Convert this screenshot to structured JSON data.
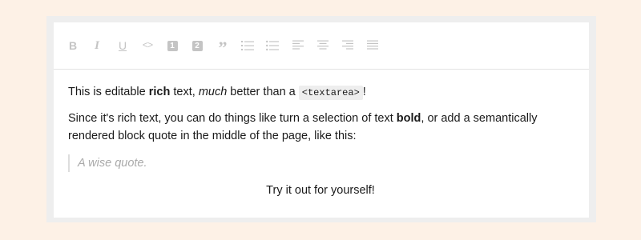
{
  "colors": {
    "page_background": "#fdf1e6",
    "frame_background": "#eeeeee",
    "editor_background": "#ffffff",
    "toolbar_icon": "#c4c4c4",
    "text": "#1a1a1a",
    "quote_text": "#aaaaaa"
  },
  "toolbar": {
    "buttons": [
      {
        "icon": "bold-icon",
        "glyph": "B"
      },
      {
        "icon": "italic-icon",
        "glyph": "I"
      },
      {
        "icon": "underline-icon",
        "glyph": "U"
      },
      {
        "icon": "code-icon",
        "glyph": "<>"
      },
      {
        "icon": "heading-one-icon",
        "glyph": "1"
      },
      {
        "icon": "heading-two-icon",
        "glyph": "2"
      },
      {
        "icon": "block-quote-icon",
        "glyph": "”"
      },
      {
        "icon": "numbered-list-icon"
      },
      {
        "icon": "bulleted-list-icon"
      },
      {
        "icon": "align-left-icon"
      },
      {
        "icon": "align-center-icon"
      },
      {
        "icon": "align-right-icon"
      },
      {
        "icon": "align-justify-icon"
      }
    ]
  },
  "content": {
    "p1": {
      "part1": "This is editable ",
      "bold": "rich",
      "part2": " text, ",
      "italic": "much",
      "part3": " better than a ",
      "code": "<textarea>",
      "part4": "!"
    },
    "p2": {
      "part1": "Since it's rich text, you can do things like turn a selection of text ",
      "bold": "bold",
      "part2": ", or add a semantically rendered block quote in the middle of the page, like this:"
    },
    "quote": "A wise quote.",
    "centered": "Try it out for yourself!"
  }
}
